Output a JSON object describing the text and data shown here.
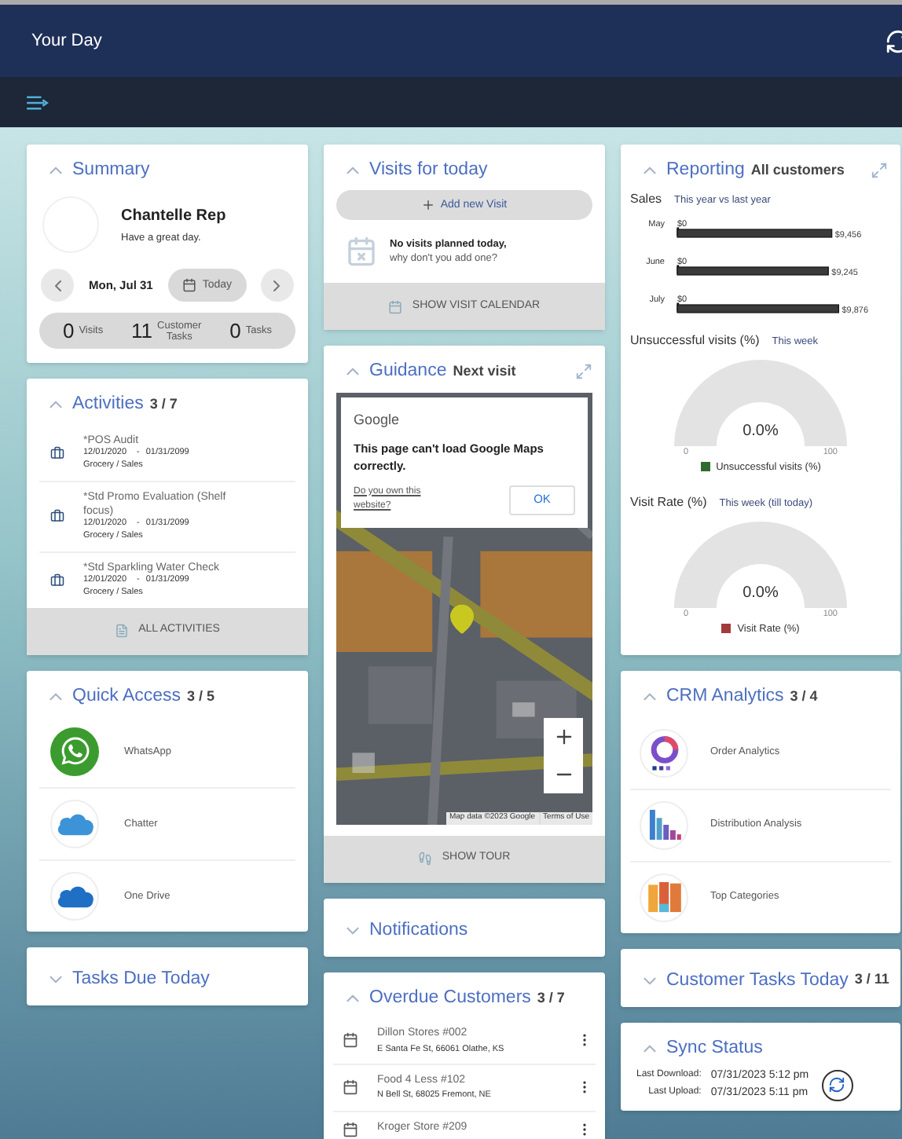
{
  "header": {
    "title": "Your Day"
  },
  "summary": {
    "title": "Summary",
    "expanded": true,
    "name": "Chantelle Rep",
    "greeting": "Have a great day.",
    "date": "Mon, Jul 31",
    "today_button": "Today",
    "stats": [
      {
        "value": "0",
        "label": "Visits"
      },
      {
        "value": "11",
        "label": "Customer Tasks"
      },
      {
        "value": "0",
        "label": "Tasks"
      }
    ]
  },
  "activities": {
    "title": "Activities",
    "count": "3 / 7",
    "expanded": true,
    "footer": "ALL ACTIVITIES",
    "items": [
      {
        "name": "*POS Audit",
        "start": "12/01/2020",
        "separator": "-",
        "end": "01/31/2099",
        "category": "Grocery / Sales"
      },
      {
        "name": "*Std Promo Evaluation (Shelf focus)",
        "start": "12/01/2020",
        "separator": "-",
        "end": "01/31/2099",
        "category": "Grocery / Sales"
      },
      {
        "name": "*Std Sparkling Water Check",
        "start": "12/01/2020",
        "separator": "-",
        "end": "01/31/2099",
        "category": "Grocery / Sales"
      }
    ]
  },
  "quick_access": {
    "title": "Quick Access",
    "count": "3 / 5",
    "expanded": true,
    "items": [
      {
        "label": "WhatsApp",
        "kind": "whatsapp"
      },
      {
        "label": "Chatter",
        "kind": "cloud"
      },
      {
        "label": "One Drive",
        "kind": "onedrive"
      }
    ]
  },
  "tasks_due": {
    "title": "Tasks Due Today",
    "expanded": false
  },
  "visits": {
    "title": "Visits for today",
    "expanded": true,
    "add_button": "Add new Visit",
    "empty_line1": "No visits planned today,",
    "empty_line2": "why don't you add one?",
    "footer": "SHOW VISIT CALENDAR"
  },
  "guidance": {
    "title": "Guidance",
    "subtitle": "Next visit",
    "expanded": true,
    "map_dialog": {
      "brand": "Google",
      "message": "This page can't load Google Maps correctly.",
      "link": "Do you own this website?",
      "button": "OK"
    },
    "map_attribution": "Map data ©2023 Google",
    "map_terms": "Terms of Use",
    "footer": "SHOW TOUR"
  },
  "notifications": {
    "title": "Notifications",
    "expanded": false
  },
  "overdue": {
    "title": "Overdue Customers",
    "count": "3 / 7",
    "expanded": true,
    "items": [
      {
        "name": "Dillon Stores #002",
        "address": "E Santa Fe St, 66061 Olathe, KS"
      },
      {
        "name": "Food 4 Less #102",
        "address": "N Bell St, 68025 Fremont, NE"
      },
      {
        "name": "Kroger Store #209"
      }
    ]
  },
  "reporting": {
    "title": "Reporting",
    "subtitle": "All customers",
    "expanded": true,
    "sales": {
      "title": "Sales",
      "subtitle": "This year vs last year",
      "chart_data": {
        "type": "bar",
        "orientation": "horizontal",
        "categories": [
          "May",
          "June",
          "July"
        ],
        "series": [
          {
            "color": "#3a3a3a",
            "values": [
              0,
              0,
              0
            ],
            "value_labels": [
              "$0",
              "$0",
              "$0"
            ]
          },
          {
            "color": "#3a3a3a",
            "values": [
              9456,
              9245,
              9876
            ],
            "value_labels": [
              "$9,456",
              "$9,245",
              "$9,876"
            ]
          }
        ]
      }
    },
    "gauges": [
      {
        "title": "Unsuccessful visits (%)",
        "subtitle": "This week",
        "reading": "0.0%",
        "min": "0",
        "max": "100",
        "legend": "Unsuccessful visits (%)",
        "color": "#2f6b2f"
      },
      {
        "title": "Visit Rate (%)",
        "subtitle": "This week (till today)",
        "reading": "0.0%",
        "min": "0",
        "max": "100",
        "legend": "Visit Rate (%)",
        "color": "#a33a3a"
      }
    ]
  },
  "crm": {
    "title": "CRM Analytics",
    "count": "3 / 4",
    "expanded": true,
    "items": [
      {
        "label": "Order Analytics",
        "kind": "donut"
      },
      {
        "label": "Distribution Analysis",
        "kind": "bars"
      },
      {
        "label": "Top Categories",
        "kind": "stacked"
      }
    ]
  },
  "customer_tasks": {
    "title": "Customer Tasks Today",
    "count": "3 / 11",
    "expanded": false
  },
  "sync": {
    "title": "Sync Status",
    "expanded": true,
    "rows": [
      {
        "label": "Last Download:",
        "value": "07/31/2023 5:12 pm"
      },
      {
        "label": "Last Upload:",
        "value": "07/31/2023 5:11 pm"
      }
    ]
  }
}
